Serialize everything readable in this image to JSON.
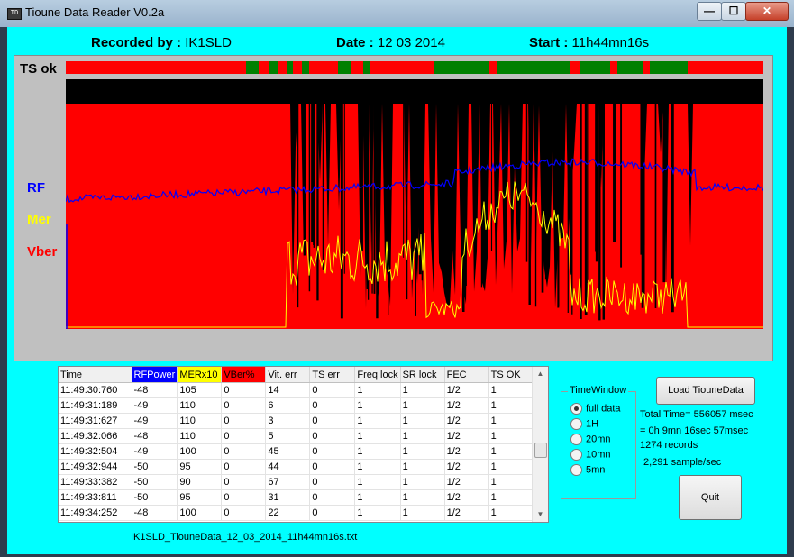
{
  "window": {
    "title": "Tioune Data Reader V0.2a",
    "icon_text": "TD",
    "min_glyph": "—",
    "max_glyph": "☐",
    "close_glyph": "✕"
  },
  "header": {
    "recorded_label": "Recorded by :",
    "recorded_value": "IK1SLD",
    "date_label": "Date :",
    "date_value": "12 03 2014",
    "start_label": "Start :",
    "start_value": "11h44mn16s"
  },
  "plot": {
    "labels": {
      "ts_ok": "TS ok",
      "rf": "RF",
      "mer": "Mer",
      "vber": "Vber"
    },
    "colors": {
      "rf": "#0000ff",
      "mer": "#ffff00",
      "vber": "#ff0000",
      "ts_ok_good": "#008000",
      "ts_bad": "#ff0000",
      "background": "#000000"
    }
  },
  "table": {
    "columns": [
      "Time",
      "RFPower",
      "MERx10",
      "VBer%",
      "Vit. err",
      "TS err",
      "Freq lock",
      "SR lock",
      "FEC",
      "TS OK"
    ],
    "header_colors": [
      "#f0f0f0",
      "#0000ff",
      "#ffff00",
      "#ff0000",
      "#f0f0f0",
      "#f0f0f0",
      "#f0f0f0",
      "#f0f0f0",
      "#f0f0f0",
      "#f0f0f0"
    ],
    "rows": [
      [
        "11:49:30:760",
        "-48",
        "105",
        "0",
        "14",
        "0",
        "1",
        "1",
        "1/2",
        "1"
      ],
      [
        "11:49:31:189",
        "-49",
        "110",
        "0",
        "6",
        "0",
        "1",
        "1",
        "1/2",
        "1"
      ],
      [
        "11:49:31:627",
        "-49",
        "110",
        "0",
        "3",
        "0",
        "1",
        "1",
        "1/2",
        "1"
      ],
      [
        "11:49:32:066",
        "-48",
        "110",
        "0",
        "5",
        "0",
        "1",
        "1",
        "1/2",
        "1"
      ],
      [
        "11:49:32:504",
        "-49",
        "100",
        "0",
        "45",
        "0",
        "1",
        "1",
        "1/2",
        "1"
      ],
      [
        "11:49:32:944",
        "-50",
        "95",
        "0",
        "44",
        "0",
        "1",
        "1",
        "1/2",
        "1"
      ],
      [
        "11:49:33:382",
        "-50",
        "90",
        "0",
        "67",
        "0",
        "1",
        "1",
        "1/2",
        "1"
      ],
      [
        "11:49:33:811",
        "-50",
        "95",
        "0",
        "31",
        "0",
        "1",
        "1",
        "1/2",
        "1"
      ],
      [
        "11:49:34:252",
        "-48",
        "100",
        "0",
        "22",
        "0",
        "1",
        "1",
        "1/2",
        "1"
      ]
    ]
  },
  "filename": "IK1SLD_TiouneData_12_03_2014_11h44mn16s.txt",
  "time_window": {
    "title": "TimeWindow",
    "options": [
      "full data",
      "1H",
      "20mn",
      "10mn",
      "5mn"
    ],
    "selected": "full data"
  },
  "buttons": {
    "load": "Load TiouneData",
    "quit": "Quit"
  },
  "info": {
    "total_time": "Total Time= 556057 msec",
    "duration": "= 0h 9mn 16sec 57msec",
    "records": "1274 records",
    "rate": "2,291 sample/sec"
  }
}
